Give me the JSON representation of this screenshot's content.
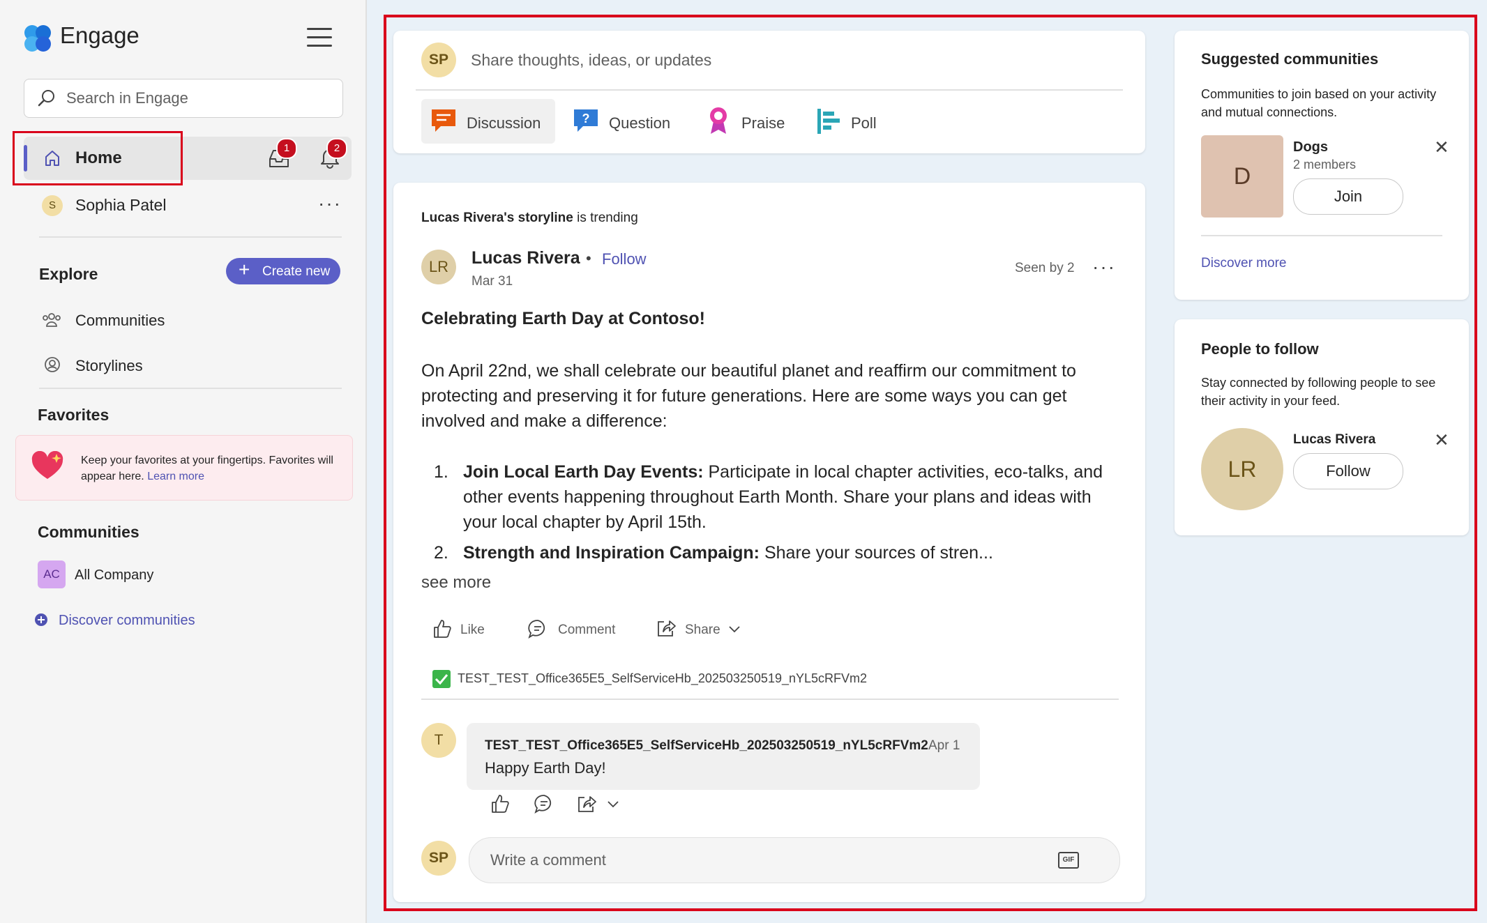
{
  "app": {
    "title": "Engage"
  },
  "sidebar": {
    "search_placeholder": "Search in Engage",
    "home_label": "Home",
    "inbox_badge": "1",
    "notifications_badge": "2",
    "user": {
      "initial": "S",
      "name": "Sophia Patel",
      "more": "···"
    },
    "explore": {
      "heading": "Explore",
      "create_label": "Create new",
      "items": [
        {
          "label": "Communities"
        },
        {
          "label": "Storylines"
        }
      ]
    },
    "favorites": {
      "heading": "Favorites",
      "text": "Keep your favorites at your fingertips. Favorites will appear here.",
      "link": "Learn more"
    },
    "communities": {
      "heading": "Communities",
      "items": [
        {
          "initials": "AC",
          "label": "All Company"
        }
      ],
      "discover": "Discover communities"
    }
  },
  "composer": {
    "avatar": "SP",
    "placeholder": "Share thoughts, ideas, or updates",
    "types": [
      {
        "label": "Discussion",
        "icon": "discussion-icon",
        "selected": true
      },
      {
        "label": "Question",
        "icon": "question-icon"
      },
      {
        "label": "Praise",
        "icon": "praise-icon"
      },
      {
        "label": "Poll",
        "icon": "poll-icon"
      }
    ]
  },
  "post": {
    "trending_name": "Lucas Rivera's storyline",
    "trending_suffix": "is trending",
    "author_initials": "LR",
    "author": "Lucas Rivera",
    "follow": "Follow",
    "date": "Mar 31",
    "seen_by": "Seen by 2",
    "title": "Celebrating Earth Day at Contoso!",
    "body": "On April 22nd, we shall celebrate our beautiful planet and reaffirm our commitment to protecting and preserving it for future generations. Here are some ways you can get involved and make a difference:",
    "list": [
      {
        "num": "1.",
        "bold": "Join Local Earth Day Events:",
        "text": " Participate in local chapter activities, eco-talks, and other events happening throughout Earth Month. Share your plans and ideas with your local chapter by April 15th."
      },
      {
        "num": "2.",
        "bold": "Strength and Inspiration Campaign:",
        "text": " Share your sources of stren..."
      }
    ],
    "see_more": "see more",
    "actions": {
      "like": "Like",
      "comment": "Comment",
      "share": "Share"
    },
    "reaction_user": "TEST_TEST_Office365E5_SelfServiceHb_202503250519_nYL5cRFVm2",
    "comment": {
      "avatar": "T",
      "author": "TEST_TEST_Office365E5_SelfServiceHb_202503250519_nYL5cRFVm2",
      "date": "Apr 1",
      "text": "Happy Earth Day!"
    },
    "write_placeholder": "Write a comment",
    "gif_label": "GIF",
    "my_avatar": "SP"
  },
  "rail": {
    "suggested": {
      "heading": "Suggested communities",
      "desc": "Communities to join based on your activity and mutual connections.",
      "community": {
        "initial": "D",
        "name": "Dogs",
        "members": "2 members",
        "action": "Join"
      },
      "discover": "Discover more"
    },
    "people": {
      "heading": "People to follow",
      "desc": "Stay connected by following people to see their activity in your feed.",
      "person": {
        "initials": "LR",
        "name": "Lucas Rivera",
        "action": "Follow"
      }
    }
  },
  "colors": {
    "accent": "#5b5fc7",
    "badge": "#c50f1f",
    "highlight_box": "#d9001b"
  }
}
